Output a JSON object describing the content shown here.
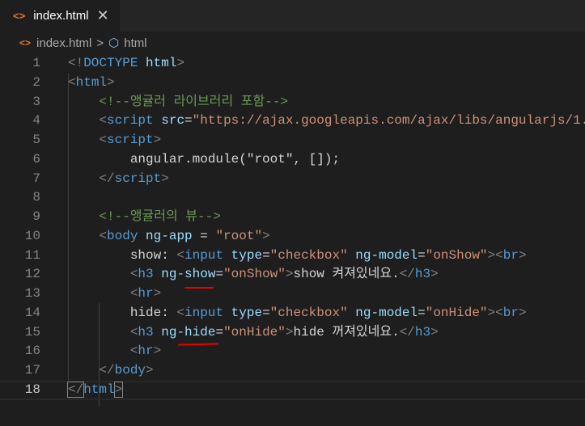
{
  "tab": {
    "icon": "html-file-icon",
    "label": "index.html",
    "close": "✕"
  },
  "breadcrumb": {
    "file": "index.html",
    "symbol": "html"
  },
  "lines": [
    [
      [
        "p",
        "<!"
      ],
      [
        "t",
        "DOCTYPE"
      ],
      [
        "x",
        " "
      ],
      [
        "a",
        "html"
      ],
      [
        "p",
        ">"
      ]
    ],
    [
      [
        "p",
        "<"
      ],
      [
        "t",
        "html"
      ],
      [
        "p",
        ">"
      ]
    ],
    [
      [
        "x",
        "    "
      ],
      [
        "c",
        "<!--앵귤러 라이브러리 포함-->"
      ]
    ],
    [
      [
        "x",
        "    "
      ],
      [
        "p",
        "<"
      ],
      [
        "t",
        "script"
      ],
      [
        "x",
        " "
      ],
      [
        "a",
        "src"
      ],
      [
        "o",
        "="
      ],
      [
        "s",
        "\"https://ajax.googleapis.com/ajax/libs/angularjs/1."
      ]
    ],
    [
      [
        "x",
        "    "
      ],
      [
        "p",
        "<"
      ],
      [
        "t",
        "script"
      ],
      [
        "p",
        ">"
      ]
    ],
    [
      [
        "x",
        "        angular.module(\"root\", []);"
      ]
    ],
    [
      [
        "x",
        "    "
      ],
      [
        "p",
        "</"
      ],
      [
        "t",
        "script"
      ],
      [
        "p",
        ">"
      ]
    ],
    [],
    [
      [
        "x",
        "    "
      ],
      [
        "c",
        "<!--앵귤러의 뷰-->"
      ]
    ],
    [
      [
        "x",
        "    "
      ],
      [
        "p",
        "<"
      ],
      [
        "t",
        "body"
      ],
      [
        "x",
        " "
      ],
      [
        "a",
        "ng-app"
      ],
      [
        "o",
        " = "
      ],
      [
        "s",
        "\"root\""
      ],
      [
        "p",
        ">"
      ]
    ],
    [
      [
        "x",
        "        show: "
      ],
      [
        "p",
        "<"
      ],
      [
        "t",
        "input"
      ],
      [
        "x",
        " "
      ],
      [
        "a",
        "type"
      ],
      [
        "o",
        "="
      ],
      [
        "s",
        "\"checkbox\""
      ],
      [
        "x",
        " "
      ],
      [
        "a",
        "ng-model"
      ],
      [
        "o",
        "="
      ],
      [
        "s",
        "\"onShow\""
      ],
      [
        "p",
        "><"
      ],
      [
        "t",
        "br"
      ],
      [
        "p",
        ">"
      ]
    ],
    [
      [
        "x",
        "        "
      ],
      [
        "p",
        "<"
      ],
      [
        "t",
        "h3"
      ],
      [
        "x",
        " "
      ],
      [
        "a",
        "ng-show"
      ],
      [
        "o",
        "="
      ],
      [
        "s",
        "\"onShow\""
      ],
      [
        "p",
        ">"
      ],
      [
        "x",
        "show 켜져있네요."
      ],
      [
        "p",
        "</"
      ],
      [
        "t",
        "h3"
      ],
      [
        "p",
        ">"
      ]
    ],
    [
      [
        "x",
        "        "
      ],
      [
        "p",
        "<"
      ],
      [
        "t",
        "hr"
      ],
      [
        "p",
        ">"
      ]
    ],
    [
      [
        "x",
        "        hide: "
      ],
      [
        "p",
        "<"
      ],
      [
        "t",
        "input"
      ],
      [
        "x",
        " "
      ],
      [
        "a",
        "type"
      ],
      [
        "o",
        "="
      ],
      [
        "s",
        "\"checkbox\""
      ],
      [
        "x",
        " "
      ],
      [
        "a",
        "ng-model"
      ],
      [
        "o",
        "="
      ],
      [
        "s",
        "\"onHide\""
      ],
      [
        "p",
        "><"
      ],
      [
        "t",
        "br"
      ],
      [
        "p",
        ">"
      ]
    ],
    [
      [
        "x",
        "        "
      ],
      [
        "p",
        "<"
      ],
      [
        "t",
        "h3"
      ],
      [
        "x",
        " "
      ],
      [
        "a",
        "ng-hide"
      ],
      [
        "o",
        "="
      ],
      [
        "s",
        "\"onHide\""
      ],
      [
        "p",
        ">"
      ],
      [
        "x",
        "hide 꺼져있네요."
      ],
      [
        "p",
        "</"
      ],
      [
        "t",
        "h3"
      ],
      [
        "p",
        ">"
      ]
    ],
    [
      [
        "x",
        "        "
      ],
      [
        "p",
        "<"
      ],
      [
        "t",
        "hr"
      ],
      [
        "p",
        ">"
      ]
    ],
    [
      [
        "x",
        "    "
      ],
      [
        "p",
        "</"
      ],
      [
        "t",
        "body"
      ],
      [
        "p",
        ">"
      ]
    ],
    [
      [
        "p",
        "</"
      ],
      [
        "t",
        "html"
      ],
      [
        "p",
        ">"
      ]
    ]
  ]
}
